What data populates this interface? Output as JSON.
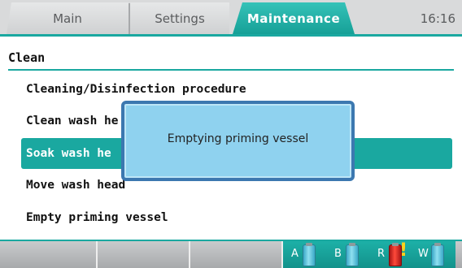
{
  "tabs": [
    {
      "label": "Main"
    },
    {
      "label": "Settings"
    },
    {
      "label": "Maintenance"
    }
  ],
  "clock": "16:16",
  "section": {
    "title": "Clean"
  },
  "menu_items": [
    {
      "label": "Cleaning/Disinfection procedure"
    },
    {
      "label": "Clean wash he"
    },
    {
      "label": "Soak wash he"
    },
    {
      "label": "Move wash head"
    },
    {
      "label": "Empty priming vessel"
    }
  ],
  "dialog": {
    "message": "Emptying priming vessel"
  },
  "bottles": [
    {
      "label": "A",
      "icon": "bottle-icon"
    },
    {
      "label": "B",
      "icon": "bottle-icon"
    },
    {
      "label": "R",
      "icon": "bottle-icon",
      "alert": "warning-icon"
    },
    {
      "label": "W",
      "icon": "bottle-icon"
    }
  ],
  "colors": {
    "accent": "#1aa8a0",
    "dialog_bg": "#8fd2ef",
    "dialog_border": "#3c78b0",
    "alert": "#e02a1f"
  }
}
